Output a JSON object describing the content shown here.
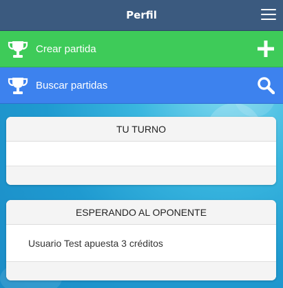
{
  "header": {
    "title": "Perfil",
    "menu_icon": "hamburger-menu-icon"
  },
  "actions": {
    "create": {
      "label": "Crear partida",
      "color": "#3ecb59",
      "icon": "trophy-icon",
      "right_icon": "plus-icon"
    },
    "search": {
      "label": "Buscar partidas",
      "color": "#3d82ee",
      "icon": "trophy-icon",
      "right_icon": "search-icon"
    }
  },
  "sections": {
    "your_turn": {
      "title": "TU TURNO",
      "items": [
        ""
      ]
    },
    "waiting": {
      "title": "ESPERANDO AL OPONENTE",
      "items": [
        "Usuario Test apuesta 3 créditos"
      ]
    }
  }
}
